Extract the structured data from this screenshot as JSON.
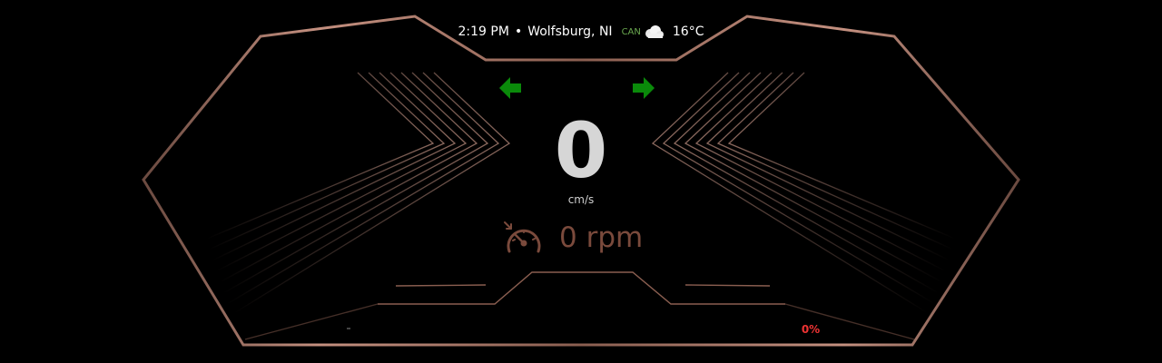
{
  "status": {
    "time": "2:19 PM",
    "separator": "•",
    "location": "Wolfsburg, NI",
    "can_label": "CAN",
    "weather_icon": "cloud-icon",
    "temperature": "16°C"
  },
  "indicators": {
    "left_turn_icon": "arrow-left-icon",
    "right_turn_icon": "arrow-right-icon",
    "turn_color": "#0a8a0a"
  },
  "speed": {
    "value": "0",
    "unit": "cm/s"
  },
  "engine": {
    "gauge_icon": "speedometer-icon",
    "rpm_text": "0 rpm"
  },
  "battery": {
    "percent_text": "0%",
    "level": 0
  },
  "theme": {
    "frame_color": "#b07a6a",
    "accent_color": "#7a4a3c",
    "warning_color": "#ee3333"
  }
}
